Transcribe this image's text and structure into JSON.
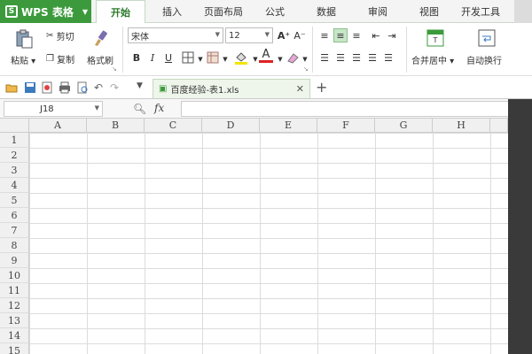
{
  "app": {
    "name": "WPS 表格",
    "logo": "S",
    "accent": "#3c9a3c"
  },
  "menu_tabs": [
    "开始",
    "插入",
    "页面布局",
    "公式",
    "数据",
    "审阅",
    "视图",
    "开发工具"
  ],
  "ribbon": {
    "paste": "粘贴",
    "cut": "剪切",
    "copy": "复制",
    "format_painter": "格式刷",
    "font_name": "宋体",
    "font_size": "12",
    "bold": "B",
    "italic": "I",
    "underline": "U",
    "merge_center": "合并居中",
    "wrap_text": "自动换行",
    "grow_font": "A⁺",
    "shrink_font": "A⁻",
    "font_color": "A"
  },
  "document": {
    "tab_title": "百度经验-表1.xls"
  },
  "formula_bar": {
    "cell_ref": "J18",
    "fx": "fx",
    "value": ""
  },
  "columns": [
    "A",
    "B",
    "C",
    "D",
    "E",
    "F",
    "G",
    "H"
  ],
  "rows": [
    "1",
    "2",
    "3",
    "4",
    "5",
    "6",
    "7",
    "8",
    "9",
    "10",
    "11",
    "12",
    "13",
    "14",
    "15"
  ]
}
